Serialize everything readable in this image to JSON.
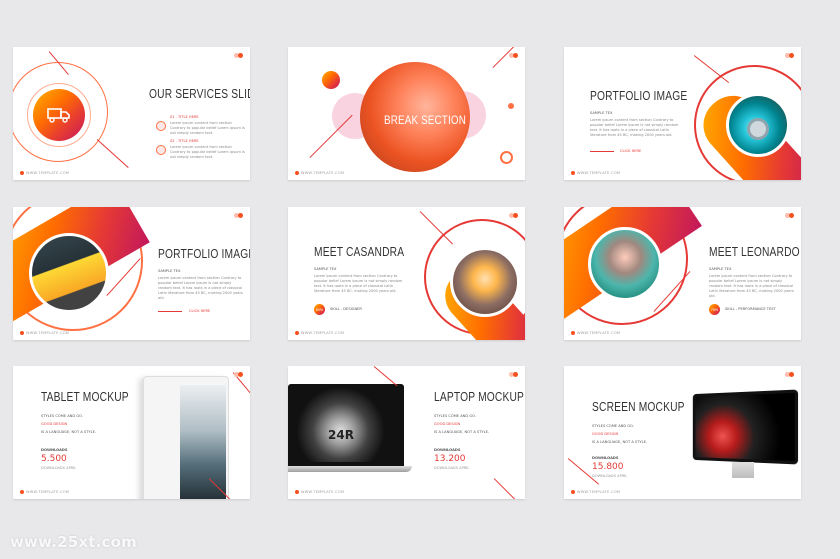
{
  "footer_text": "WWW.TEMPLATE.COM",
  "watermark": "www.25xt.com",
  "colors": {
    "accent": "#e53935",
    "orange": "#ff6d00",
    "amber": "#ffb300",
    "magenta": "#c2185b",
    "background": "#e8e8ea"
  },
  "slides": [
    {
      "title": "OUR SERVICES SLIDES",
      "icon": "truck-icon",
      "items": [
        {
          "label": "01 . TITLE HERE",
          "text": "Lorem ipsum content from section Contrary to popular belief Lorem ipsum is not simply random text."
        },
        {
          "label": "02 . TITLE HERE",
          "text": "Lorem ipsum content from section Contrary to popular belief Lorem ipsum is not simply random text."
        }
      ]
    },
    {
      "title": "BREAK SECTION"
    },
    {
      "title": "PORTFOLIO IMAGE",
      "sub": "SAMPLE TEX",
      "body": "Lorem ipsum content from section Contrary to popular belief Lorem ipsum is not simply random text. It has roots in a piece of classical Latin literature from 45 BC, making 2000 years old.",
      "link": "CLICK HERE"
    },
    {
      "title": "PORTFOLIO IMAGE",
      "sub": "SAMPLE TEX",
      "body": "Lorem ipsum content from section Contrary to popular belief Lorem ipsum is not simply random text. It has roots in a piece of classical Latin literature from 45 BC, making 2000 years old.",
      "link": "CLICK HERE"
    },
    {
      "title": "MEET CASANDRA",
      "sub": "SAMPLE TEX",
      "body": "Lorem ipsum content from section Contrary to popular belief Lorem ipsum is not simply random text. It has roots in a piece of classical Latin literature from 45 BC, making 2000 years old.",
      "skill_pct": "80%",
      "skill": "SKILL - DESIGNER"
    },
    {
      "title": "MEET LEONARDO",
      "sub": "SAMPLE TEX",
      "body": "Lorem ipsum content from section Contrary to popular belief Lorem ipsum is not simply random text. It has roots in a piece of classical Latin literature from 45 BC, making 2000 years old.",
      "skill_pct": "75%",
      "skill": "SKILL - PERFORMANCE TEST"
    },
    {
      "title": "TABLET MOCKUP",
      "line1": "STYLES COME AND GO.",
      "line2": "GOOD DESIGN",
      "line3": "IS A LANGUAGE, NOT A STYLE.",
      "stat_label": "DOWNLOADS",
      "stat": "5.500",
      "stat_caption": "DOWNLOADS APRIL"
    },
    {
      "title": "LAPTOP MOCKUP",
      "line1": "STYLES COME AND GO.",
      "line2": "GOOD DESIGN",
      "line3": "IS A LANGUAGE, NOT A STYLE.",
      "stat_label": "DOWNLOADS",
      "stat": "13.200",
      "stat_caption": "DOWNLOADS APRIL",
      "gear_text": "24R"
    },
    {
      "title": "SCREEN MOCKUP",
      "line1": "STYLES COME AND GO.",
      "line2": "GOOD DESIGN",
      "line3": "IS A LANGUAGE, NOT A STYLE.",
      "stat_label": "DOWNLOADS",
      "stat": "15.800",
      "stat_caption": "DOWNLOADS APRIL"
    }
  ]
}
